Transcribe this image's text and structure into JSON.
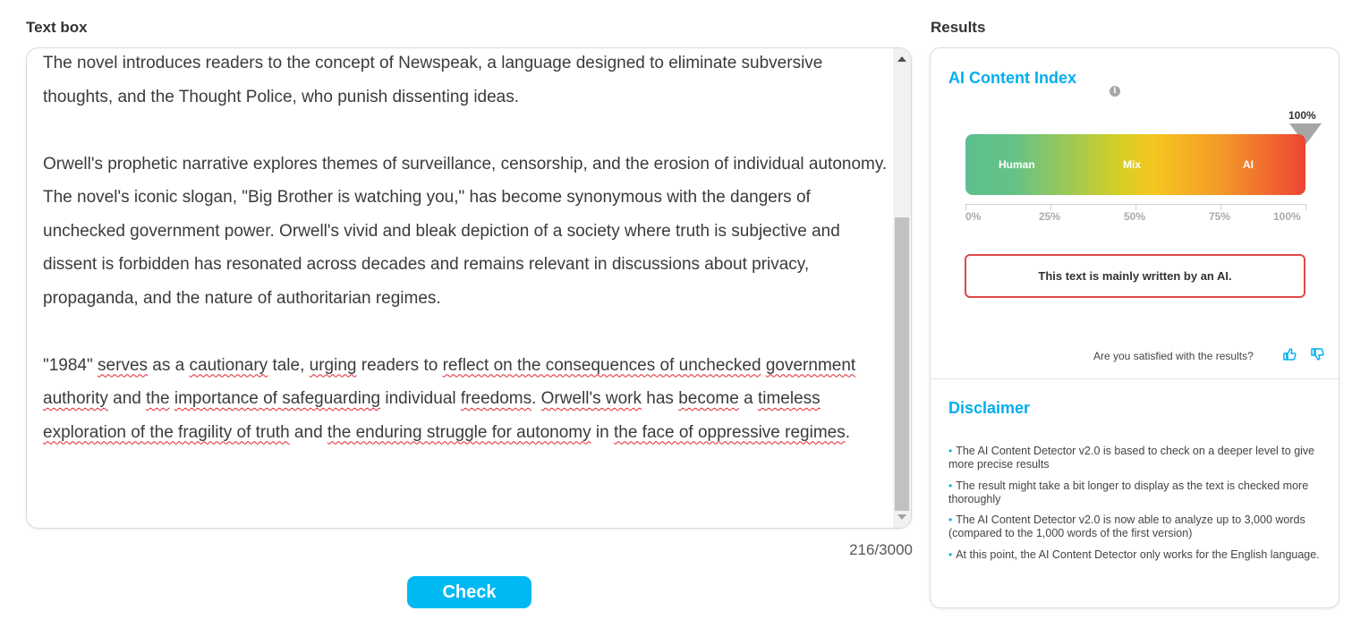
{
  "text_box": {
    "label": "Text box",
    "paragraphs": [
      [
        {
          "t": "The novel introduces readers to the concept of Newspeak, a language designed to eliminate subversive thoughts, and the Thought Police, who punish dissenting ideas."
        }
      ],
      [
        {
          "t": "Orwell's prophetic narrative explores themes of surveillance, censorship, and the erosion of individual autonomy. The novel's iconic slogan, \"Big Brother is watching you,\" has become synonymous with the dangers of unchecked government power. Orwell's vivid and bleak depiction of a society where truth is subjective and dissent is forbidden has resonated across decades and remains relevant in discussions about privacy, propaganda, and the nature of authoritarian regimes."
        }
      ],
      [
        {
          "t": "\"1984\" "
        },
        {
          "t": "serves",
          "u": true
        },
        {
          "t": " as a "
        },
        {
          "t": "cautionary",
          "u": true
        },
        {
          "t": " tale, "
        },
        {
          "t": "urging",
          "u": true
        },
        {
          "t": " readers to "
        },
        {
          "t": "reflect on the consequences of unchecked",
          "u": true
        },
        {
          "t": " "
        },
        {
          "t": "government authority",
          "u": true
        },
        {
          "t": " and "
        },
        {
          "t": "the",
          "u": true
        },
        {
          "t": " "
        },
        {
          "t": "importance of safeguarding",
          "u": true
        },
        {
          "t": " individual "
        },
        {
          "t": "freedoms",
          "u": true
        },
        {
          "t": ". "
        },
        {
          "t": "Orwell's work",
          "u": true
        },
        {
          "t": " has "
        },
        {
          "t": "become",
          "u": true
        },
        {
          "t": " a "
        },
        {
          "t": "timeless exploration of the fragility of truth",
          "u": true
        },
        {
          "t": " and "
        },
        {
          "t": "the enduring struggle for autonomy",
          "u": true
        },
        {
          "t": " in "
        },
        {
          "t": "the face of oppressive regimes",
          "u": true
        },
        {
          "t": "."
        }
      ]
    ],
    "word_count": "216/3000"
  },
  "check_button": {
    "label": "Check"
  },
  "results": {
    "label": "Results",
    "index_title": "AI Content Index",
    "info_icon_glyph": "i",
    "percentage_label": "100%",
    "ai_percentage": 100,
    "gauge_labels": {
      "human": "Human",
      "mix": "Mix",
      "ai": "AI"
    },
    "scale_ticks": [
      "0%",
      "25%",
      "50%",
      "75%",
      "100%"
    ],
    "verdict": "This text is mainly written by an AI.",
    "verdict_color": "#e04848",
    "feedback_prompt": "Are you satisfied with the results?"
  },
  "disclaimer": {
    "title": "Disclaimer",
    "items": [
      "The AI Content Detector v2.0 is based to check on a deeper level to give more precise results",
      "The result might take a bit longer to display as the text is checked more thoroughly",
      "The AI Content Detector v2.0 is now able to analyze up to 3,000 words (compared to the 1,000 words of the first version)",
      "At this point, the AI Content Detector only works for the English language."
    ]
  },
  "colors": {
    "accent": "#00aeef",
    "button": "#00b9f2",
    "gauge_human": "#5cc08f",
    "gauge_mix": "#f5c71f",
    "gauge_ai": "#ee4434"
  },
  "icons": {
    "info": "info-icon",
    "thumbs_up": "thumbs-up-icon",
    "thumbs_down": "thumbs-down-icon",
    "scroll_up": "scroll-up-arrow-icon",
    "scroll_down": "scroll-down-arrow-icon",
    "marker": "triangle-marker-icon"
  }
}
